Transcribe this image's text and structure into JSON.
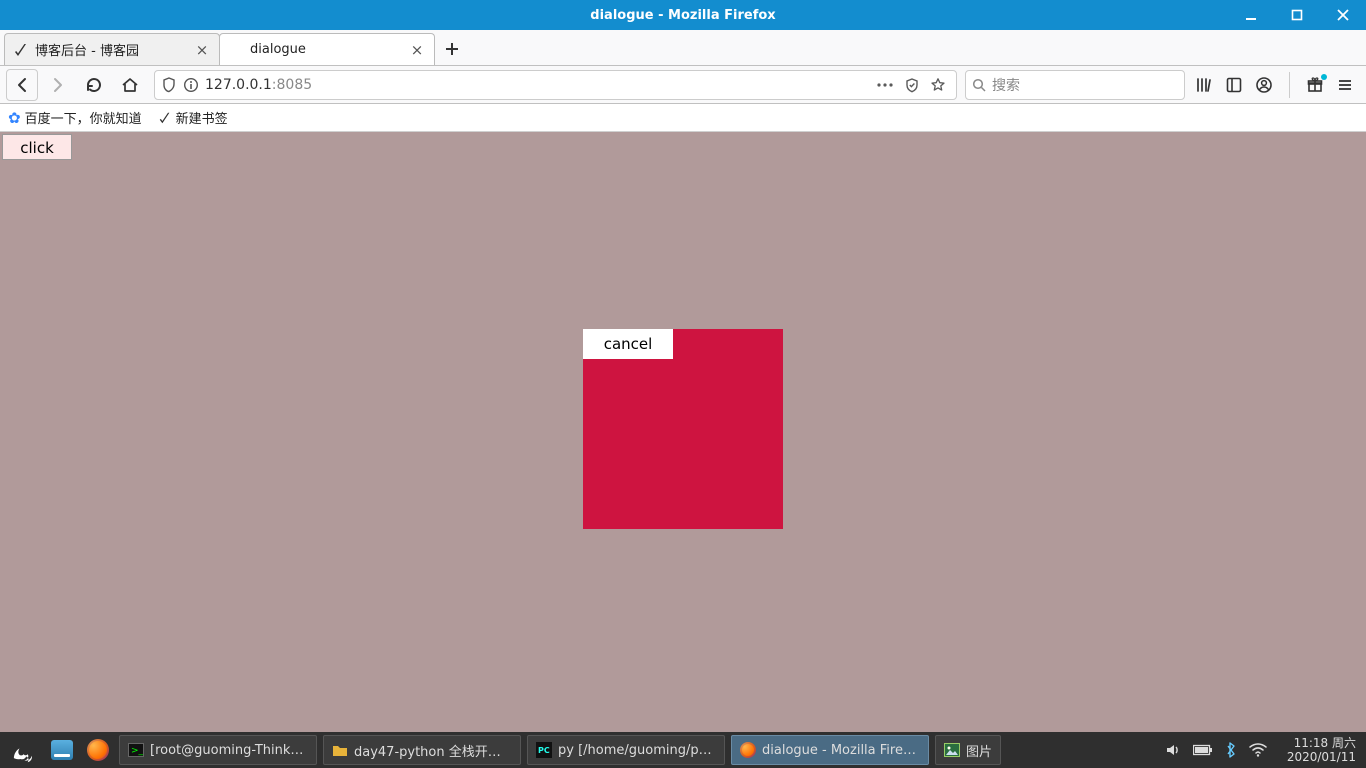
{
  "window_title": "dialogue - Mozilla Firefox",
  "tabs": [
    {
      "title": "博客后台 - 博客园",
      "active": false
    },
    {
      "title": "dialogue",
      "active": true
    }
  ],
  "url": {
    "host": "127.0.0.1",
    "port": ":8085"
  },
  "search_placeholder": "搜索",
  "bookmarks": [
    {
      "label": "百度一下，你就知道"
    },
    {
      "label": "新建书签"
    }
  ],
  "page": {
    "click_label": "click",
    "cancel_label": "cancel"
  },
  "taskbar": [
    {
      "title": "[root@guoming-ThinkP...",
      "icon": "terminal",
      "active": false
    },
    {
      "title": "day47-python 全栈开发-...",
      "icon": "folder",
      "active": false
    },
    {
      "title": "py [/home/guoming/py]...",
      "icon": "pycharm",
      "active": false
    },
    {
      "title": "dialogue - Mozilla Firefox",
      "icon": "firefox",
      "active": true
    },
    {
      "title": "图片",
      "icon": "image",
      "active": false
    }
  ],
  "clock": {
    "time": "11:18",
    "day": "周六",
    "date": "2020/01/11"
  }
}
